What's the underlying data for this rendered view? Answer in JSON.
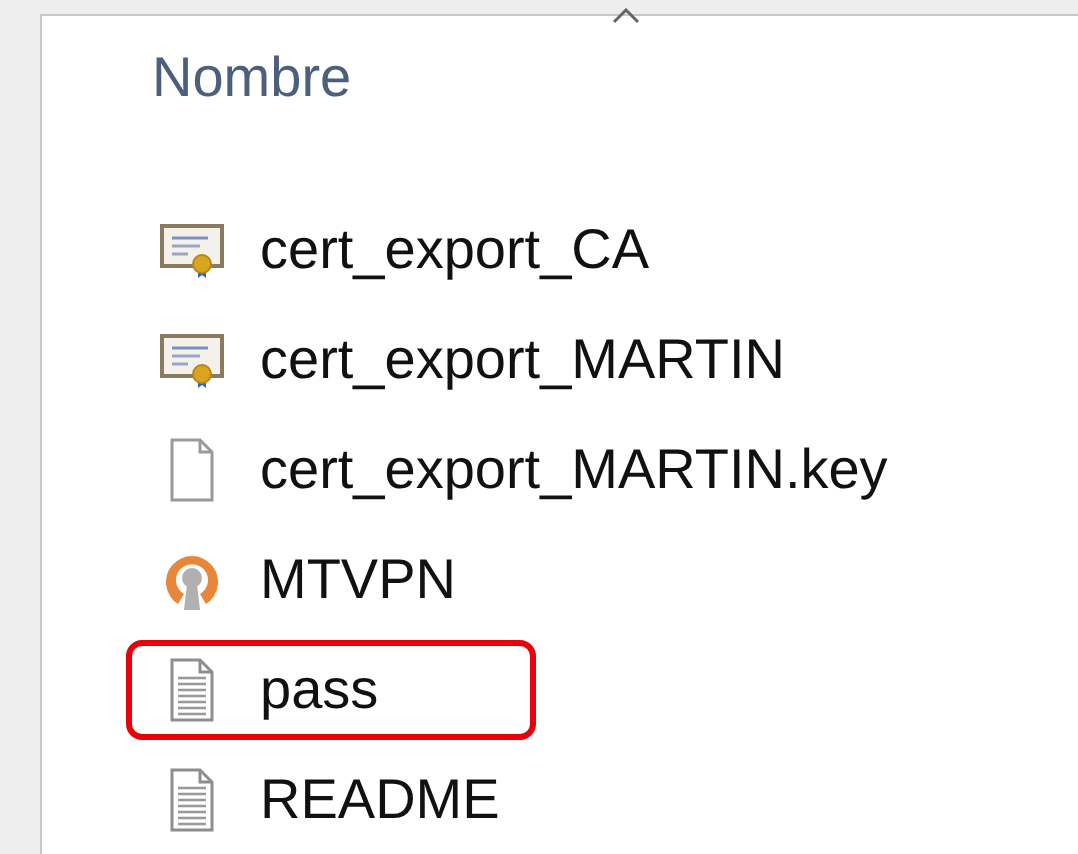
{
  "column_header": "Nombre",
  "files": [
    {
      "name": "cert_export_CA",
      "kind": "certificate",
      "highlighted": false
    },
    {
      "name": "cert_export_MARTIN",
      "kind": "certificate",
      "highlighted": false
    },
    {
      "name": "cert_export_MARTIN.key",
      "kind": "blank",
      "highlighted": false
    },
    {
      "name": "MTVPN",
      "kind": "vpn",
      "highlighted": false
    },
    {
      "name": "pass",
      "kind": "text",
      "highlighted": true
    },
    {
      "name": "README",
      "kind": "text",
      "highlighted": false
    }
  ]
}
